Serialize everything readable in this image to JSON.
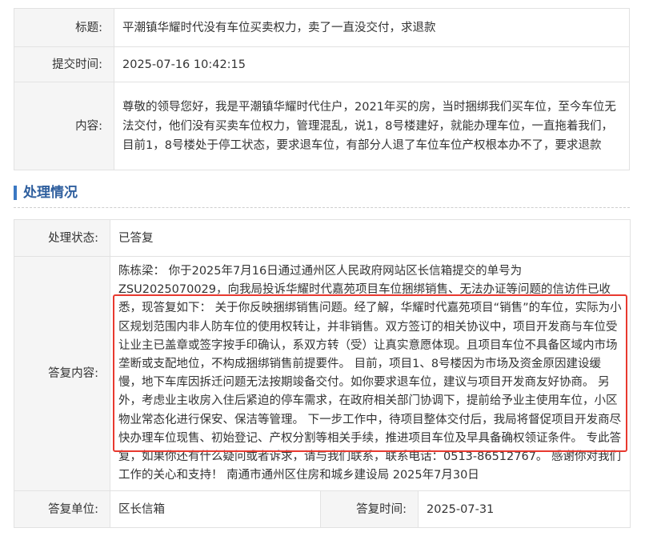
{
  "complaint": {
    "title_label": "标题:",
    "title_value": "平潮镇华耀时代没有车位买卖权力，卖了一直没交付，求退款",
    "time_label": "提交时间:",
    "time_value": "2025-07-16 10:42:15",
    "content_label": "内容:",
    "content_value": "尊敬的领导您好，我是平潮镇华耀时代住户，2021年买的房，当时捆绑我们买车位，至今车位无法交付，他们没有买卖车位权力，管理混乱，说1，8号楼建好，就能办理车位，一直拖着我们，目前1，8号楼处于停工状态，要求退车位，有部分人退了车位车位产权根本办不了，要求退款"
  },
  "section": {
    "title": "处理情况"
  },
  "handling": {
    "status_label": "处理状态:",
    "status_value": "已答复",
    "reply_label": "答复内容:",
    "reply_value": "陈栋梁：  你于2025年7月16日通过通州区人民政府网站区长信箱提交的单号为ZSU2025070029，向我局投诉华耀时代嘉苑项目车位捆绑销售、无法办证等问题的信访件已收悉，现答复如下：  关于你反映捆绑销售问题。经了解，华耀时代嘉苑项目“销售”的车位，实际为小区规划范围内非人防车位的使用权转让，并非销售。双方签订的相关协议中，项目开发商与车位受让业主已盖章或签字按手印确认，系双方转（受）让真实意愿体现。且项目车位不具备区域内市场垄断或支配地位，不构成捆绑销售前提要件。  目前，项目1、8号楼因为市场及资金原因建设缓慢，地下车库因拆迁问题无法按期竣备交付。如你要求退车位，建议与项目开发商友好协商。  另外，考虑业主收房入住后紧迫的停车需求，在政府相关部门协调下，提前给予业主使用车位，小区物业常态化进行保安、保洁等管理。  下一步工作中，待项目整体交付后，我局将督促项目开发商尽快办理车位现售、初始登记、产权分割等相关手续，推进项目车位及早具备确权领证条件。  专此答复，如果你还有什么疑问或者诉求，请与我们联系，联系电话：0513-86512767。  感谢你对我们工作的关心和支持！  南通市通州区住房和城乡建设局 2025年7月30日",
    "unit_label": "答复单位:",
    "unit_value": "区长信箱",
    "reply_time_label": "答复时间:",
    "reply_time_value": "2025-07-31"
  },
  "colors": {
    "accent": "#3a78c3",
    "section_title": "#2f5f9e",
    "highlight": "#e8392f",
    "label_bg": "#f5f5f5",
    "border": "#e2e2e2"
  }
}
